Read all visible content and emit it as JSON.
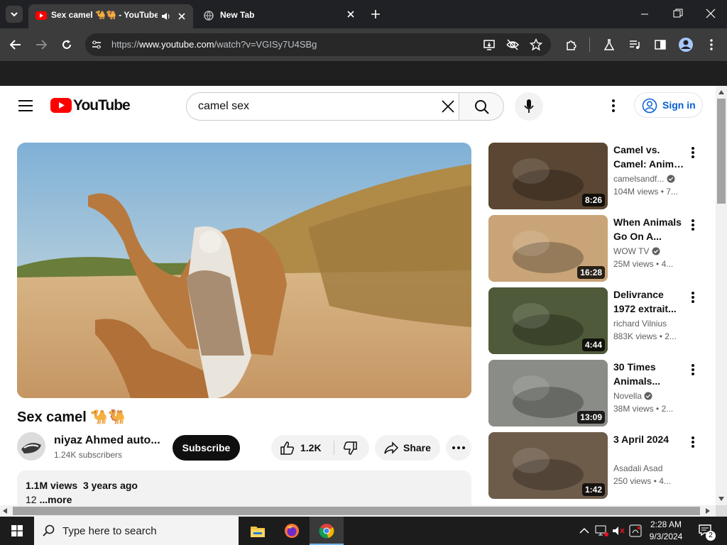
{
  "browser": {
    "tabs": [
      {
        "title": "Sex camel 🐪🐫 - YouTube"
      },
      {
        "title": "New Tab"
      }
    ],
    "url_prefix": "https://",
    "url_domain": "www.youtube.com",
    "url_path": "/watch?v=VGISy7U4SBg"
  },
  "youtube": {
    "logo_text": "YouTube",
    "search_value": "camel sex",
    "signin_label": "Sign in",
    "video_title": "Sex camel 🐪🐫",
    "channel_name": "niyaz Ahmed auto...",
    "subscribers": "1.24K subscribers",
    "subscribe_label": "Subscribe",
    "likes": "1.2K",
    "share_label": "Share",
    "views": "1.1M views",
    "age": "3 years ago",
    "desc_line": "12",
    "more_label": "...more"
  },
  "recommendations": [
    {
      "title1": "Camel vs.",
      "title2": "Camel: Anima...",
      "channel": "camelsandf...",
      "verified": true,
      "views": "104M views",
      "age": "• 7...",
      "duration": "8:26",
      "thumb": "#5a4632"
    },
    {
      "title1": "When Animals",
      "title2": "Go On A...",
      "channel": "WOW TV",
      "verified": true,
      "views": "25M views",
      "age": "• 4...",
      "duration": "16:28",
      "thumb": "#c9a478"
    },
    {
      "title1": "Delivrance",
      "title2": "1972 extrait...",
      "channel": "richard Vilnius",
      "verified": false,
      "views": "883K views",
      "age": "• 2...",
      "duration": "4:44",
      "thumb": "#4f5a3a"
    },
    {
      "title1": "30 Times",
      "title2": "Animals...",
      "channel": "Novella",
      "verified": true,
      "views": "38M views",
      "age": "• 2...",
      "duration": "13:09",
      "thumb": "#8a8d87"
    },
    {
      "title1": "3 April 2024",
      "title2": "",
      "channel": "Asadali Asad",
      "verified": false,
      "views": "250 views",
      "age": "• 4...",
      "duration": "1:42",
      "thumb": "#6e5c4a"
    }
  ],
  "taskbar": {
    "search_placeholder": "Type here to search",
    "time": "2:28 AM",
    "date": "9/3/2024",
    "notifications": "2"
  },
  "colors": {
    "yt_red": "#ff0000",
    "link_blue": "#065fd4",
    "taskbar": "#1c1c1c"
  }
}
